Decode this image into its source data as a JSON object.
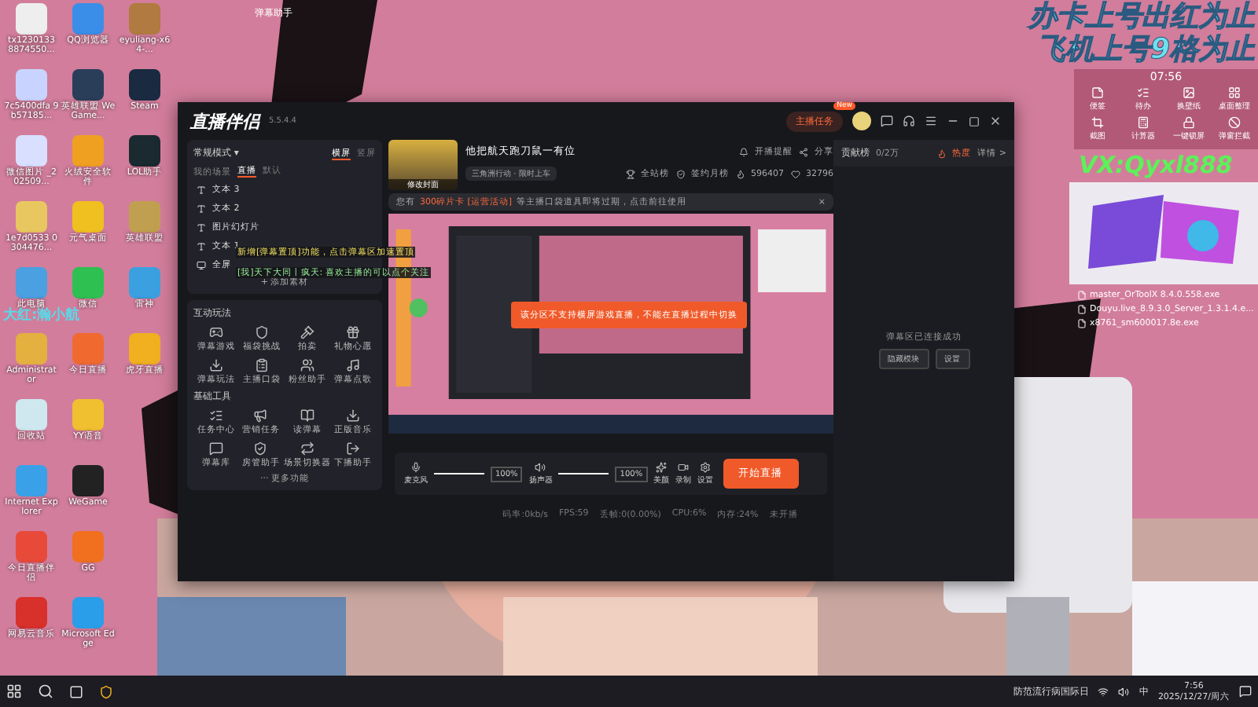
{
  "desktop_icons": [
    {
      "label": "tx1230133 8874550..."
    },
    {
      "label": "7c5400dfa 9b57185..."
    },
    {
      "label": "微信图片 _202509..."
    },
    {
      "label": "1e7d0533 0304476..."
    },
    {
      "label": "此电脑"
    },
    {
      "label": "Administrator"
    },
    {
      "label": "回收站"
    },
    {
      "label": "Internet Explorer"
    },
    {
      "label": "今日直播伴侣"
    },
    {
      "label": "网易云音乐"
    },
    {
      "label": "QQ浏览器"
    },
    {
      "label": "英雄联盟 WeGame..."
    },
    {
      "label": "火绒安全软件"
    },
    {
      "label": "元气桌面"
    },
    {
      "label": "微信"
    },
    {
      "label": "今日直播"
    },
    {
      "label": "YY语音"
    },
    {
      "label": "WeGame"
    },
    {
      "label": "GG"
    },
    {
      "label": "Microsoft Edge"
    },
    {
      "label": "eyuliang-x64-..."
    },
    {
      "label": "Steam"
    },
    {
      "label": "LOL助手"
    },
    {
      "label": "英雄联盟"
    },
    {
      "label": "雷神"
    },
    {
      "label": "虎牙直播"
    }
  ],
  "overlay_texts": {
    "headline": [
      "办卡上号出红为止",
      "飞机上号9格为止"
    ],
    "contact": "VX:Qyxl888",
    "side_note": "大红:瀚小航",
    "assistant_title": "弹幕助手"
  },
  "widget": {
    "time": "07:56",
    "tools": [
      "便签",
      "待办",
      "换壁纸",
      "桌面整理",
      "截图",
      "计算器",
      "一键锁屏",
      "弹窗拦截"
    ]
  },
  "files": [
    "master_OrToolX 8.4.0.558.exe",
    "Douyu.live_8.9.3.0_Server_1.3.1.4.e...",
    "x8761_sm600017.8e.exe"
  ],
  "window": {
    "title": "直播伴侣",
    "version": "5.5.4.4",
    "task_button": "主播任务",
    "task_badge": "New"
  },
  "left_panel": {
    "mode": "常规模式 ▾",
    "orientation_tabs": [
      {
        "label": "横屏",
        "selected": true
      },
      {
        "label": "竖屏",
        "selected": false
      }
    ],
    "scene_label": "我的场景",
    "scene_tabs": [
      {
        "label": "直播",
        "selected": true
      },
      {
        "label": "默认",
        "selected": false
      }
    ],
    "sources": [
      {
        "name": "文本 3",
        "kind": "text"
      },
      {
        "name": "文本 2",
        "kind": "text"
      },
      {
        "name": "图片幻灯片",
        "kind": "text"
      },
      {
        "name": "文本 1",
        "kind": "text"
      },
      {
        "name": "全屏",
        "kind": "screen"
      }
    ],
    "add_source": "+ 添加素材",
    "interactive_title": "互动玩法",
    "interactive": [
      "弹幕游戏",
      "福袋挑战",
      "拍卖",
      "礼物心愿",
      "弹幕玩法",
      "主播口袋",
      "粉丝助手",
      "弹幕点歌"
    ],
    "tools_title": "基础工具",
    "tools": [
      "任务中心",
      "营销任务",
      "读弹幕",
      "正版音乐",
      "弹幕库",
      "房管助手",
      "场景切换器",
      "下播助手"
    ],
    "more": "··· 更多功能"
  },
  "chat_overlay": [
    "新增[弹幕置顶]功能，点击弹幕区加速置顶",
    "[我]天下大同丨疯天: 喜欢主播的可以点个关注"
  ],
  "room": {
    "cover_label": "修改封面",
    "title": "他把航天跑刀鼠一有位",
    "category": "三角洲行动 · 限时上车",
    "remind": "开播提醒",
    "share": "分享",
    "rank": "全站榜",
    "monthly": "签约月榜",
    "likes": "596407",
    "fans": "32796"
  },
  "notice": {
    "prefix": "您有",
    "highlight": "300碎片卡 [运营活动]",
    "rest": "等主播口袋道具即将过期，点击前往使用",
    "close": "×"
  },
  "toast": "该分区不支持横屏游戏直播，不能在直播过程中切换",
  "controls": {
    "mic": {
      "label": "麦克风",
      "level": 1,
      "reading": "100%"
    },
    "speaker": {
      "label": "扬声器",
      "level": 1,
      "reading": "100%"
    },
    "beauty": "美颜",
    "record": "录制",
    "settings": "设置",
    "start": "开始直播"
  },
  "status": [
    "码率:0kb/s",
    "FPS:59",
    "丢帧:0(0.00%)",
    "CPU:6%",
    "内存:24%",
    "未开播"
  ],
  "right_panel": {
    "title": "贡献榜",
    "count": "0/2万",
    "heat": "热度",
    "details": "详情 >",
    "message": "弹幕区已连接成功",
    "buttons": [
      "隐藏模块",
      "设置"
    ]
  },
  "taskbar": {
    "news": "防范流行病国际日",
    "ime": "中",
    "time": "7:56",
    "date": "2025/12/27/周六"
  }
}
